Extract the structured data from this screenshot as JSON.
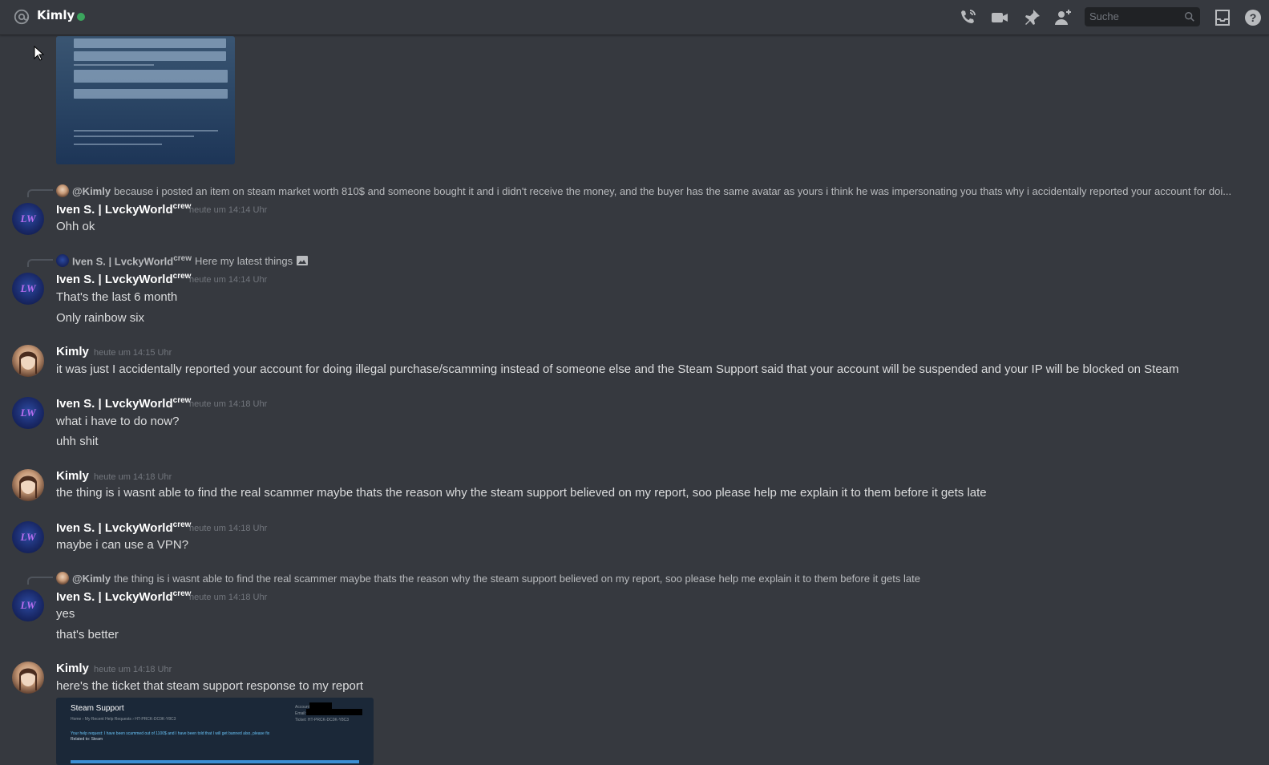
{
  "header": {
    "channel_name": "Kimly",
    "search_placeholder": "Suche",
    "icons": [
      "at-icon",
      "phone-call-icon",
      "video-icon",
      "pin-icon",
      "add-friend-icon",
      "search-icon",
      "inbox-icon",
      "help-icon"
    ],
    "status_color": "#3ba55d"
  },
  "messages": [
    {
      "reply": {
        "mention": "@Kimly",
        "text": "because i posted an item on steam market worth 810$ and someone bought it and i didn't receive the money, and the buyer has the same avatar as yours i think he was impersonating you thats why i accidentally reported your account for doi..."
      },
      "author": "Iven S. | LvckyWorld",
      "author_tag": "crew",
      "timestamp": "heute um 14:14 Uhr",
      "lines": [
        "Ohh ok"
      ]
    },
    {
      "reply": {
        "name": "Iven S. | LvckyWorld",
        "name_tag": "crew",
        "text": "Here my latest things"
      },
      "author": "Iven S. | LvckyWorld",
      "author_tag": "crew",
      "timestamp": "heute um 14:14 Uhr",
      "lines": [
        "That's the last 6 month",
        "Only rainbow six"
      ]
    },
    {
      "author": "Kimly",
      "timestamp": "heute um 14:15 Uhr",
      "lines": [
        "it was just I accidentally reported your account for doing illegal purchase/scamming instead of someone else and the Steam Support said that your account will be suspended and your IP will be blocked on Steam"
      ]
    },
    {
      "author": "Iven S. | LvckyWorld",
      "author_tag": "crew",
      "timestamp": "heute um 14:18 Uhr",
      "lines": [
        "what i have to do now?",
        "uhh shit"
      ]
    },
    {
      "author": "Kimly",
      "timestamp": "heute um 14:18 Uhr",
      "lines": [
        "the thing is i wasnt able to find the real scammer maybe thats the reason why the steam support believed on my report, soo please help me explain it to them before it gets late"
      ]
    },
    {
      "author": "Iven S. | LvckyWorld",
      "author_tag": "crew",
      "timestamp": "heute um 14:18 Uhr",
      "lines": [
        "maybe i can use a VPN?"
      ]
    },
    {
      "reply": {
        "mention": "@Kimly",
        "text": "the thing is i wasnt able to find the real scammer maybe thats the reason why the steam support believed on my report, soo please help me explain it to them before it gets late"
      },
      "author": "Iven S. | LvckyWorld",
      "author_tag": "crew",
      "timestamp": "heute um 14:18 Uhr",
      "lines": [
        "yes",
        "that's better"
      ]
    },
    {
      "author": "Kimly",
      "timestamp": "heute um 14:18 Uhr",
      "lines": [
        "here's the ticket that steam support response to my report"
      ]
    }
  ],
  "ticket_image": {
    "title": "Steam Support",
    "breadcrumb": "Home › My Recent Help Requests › HT-PRCK-DC0K-Y8C3",
    "body": "Your help request: I have been scammed out of 1100$ and I have been told that I will get banned also, please fix",
    "related": "Related to: Steam",
    "meta_account": "Account:",
    "meta_email": "Email:",
    "meta_ticket": "Ticket: HT-PRCK-DC0K-Y8C3"
  }
}
